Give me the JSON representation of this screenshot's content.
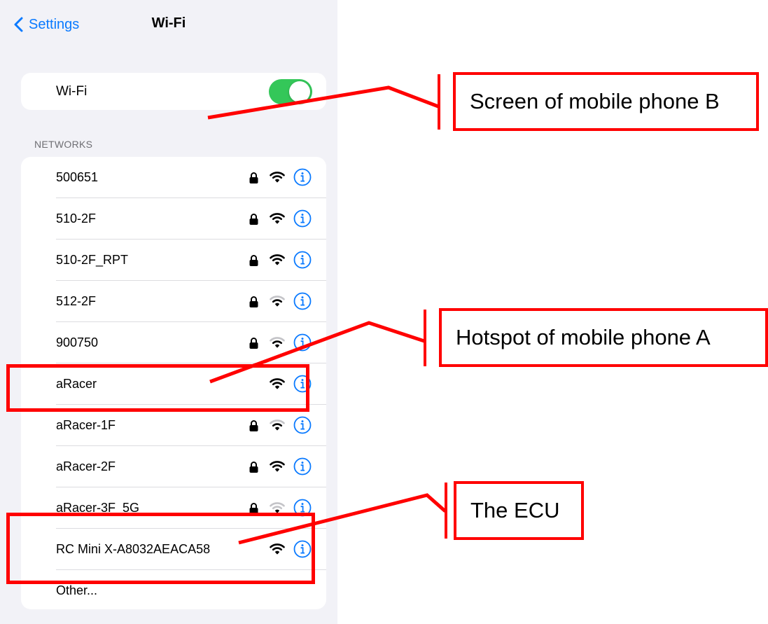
{
  "navbar": {
    "back_label": "Settings",
    "title": "Wi-Fi"
  },
  "wifi_toggle": {
    "label": "Wi-Fi",
    "state": "on",
    "color": "#34c759"
  },
  "networks_section": {
    "header": "NETWORKS"
  },
  "networks": [
    {
      "name": "500651",
      "locked": true,
      "signal": "strong"
    },
    {
      "name": "510-2F",
      "locked": true,
      "signal": "strong"
    },
    {
      "name": "510-2F_RPT",
      "locked": true,
      "signal": "strong"
    },
    {
      "name": "512-2F",
      "locked": true,
      "signal": "medium"
    },
    {
      "name": "900750",
      "locked": true,
      "signal": "medium"
    },
    {
      "name": "aRacer",
      "locked": false,
      "signal": "strong"
    },
    {
      "name": "aRacer-1F",
      "locked": true,
      "signal": "medium"
    },
    {
      "name": "aRacer-2F",
      "locked": true,
      "signal": "strong"
    },
    {
      "name": "aRacer-3F_5G",
      "locked": true,
      "signal": "weak"
    },
    {
      "name": "RC Mini X-A8032AEACA58",
      "locked": false,
      "signal": "strong"
    },
    {
      "name": "Other...",
      "locked": false,
      "signal": "none"
    }
  ],
  "annotations": {
    "screen_b": "Screen of mobile phone B",
    "hotspot_a": "Hotspot of mobile phone A",
    "ecu": "The ECU"
  },
  "colors": {
    "accent": "#0a7aff",
    "annotation": "#ff0000",
    "toggle_on": "#34c759",
    "background": "#f2f2f7"
  }
}
